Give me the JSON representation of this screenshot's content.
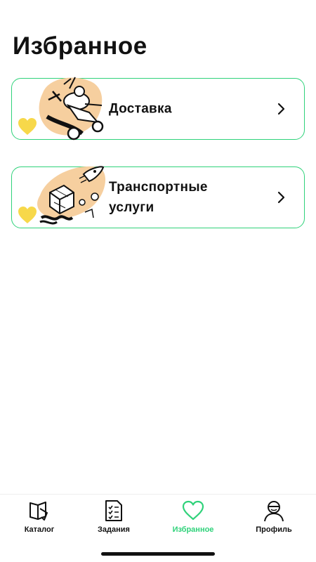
{
  "header": {
    "title": "Избранное"
  },
  "favorites": [
    {
      "label": "Доставка",
      "icon": "delivery-illustration",
      "favorite": true
    },
    {
      "label": "Транспортные услуги",
      "icon": "transport-illustration",
      "favorite": true
    }
  ],
  "tabbar": {
    "items": [
      {
        "label": "Каталог",
        "icon": "catalog-book-icon",
        "active": false
      },
      {
        "label": "Задания",
        "icon": "tasks-checklist-icon",
        "active": false
      },
      {
        "label": "Избранное",
        "icon": "heart-icon",
        "active": true
      },
      {
        "label": "Профиль",
        "icon": "profile-avatar-icon",
        "active": false
      }
    ]
  },
  "colors": {
    "accent": "#2fd27a",
    "heart_favorite": "#f7d84a",
    "illustration_blob": "#f6cf9f"
  }
}
